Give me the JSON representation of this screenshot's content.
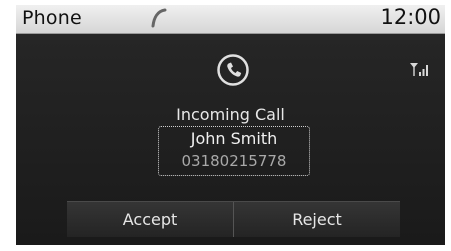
{
  "status_bar": {
    "title": "Phone",
    "time": "12:00",
    "handset_icon": "handset-icon"
  },
  "call": {
    "icon": "phone-circle-icon",
    "signal_icon": "signal-strength-icon",
    "status": "Incoming Call",
    "caller_name": "John Smith",
    "caller_number": "03180215778"
  },
  "actions": {
    "accept_label": "Accept",
    "reject_label": "Reject"
  },
  "colors": {
    "background": "#1e1e1e",
    "status_bar": "#e2e2e2",
    "text": "#e8e8e8",
    "number": "#a9a9a9"
  }
}
